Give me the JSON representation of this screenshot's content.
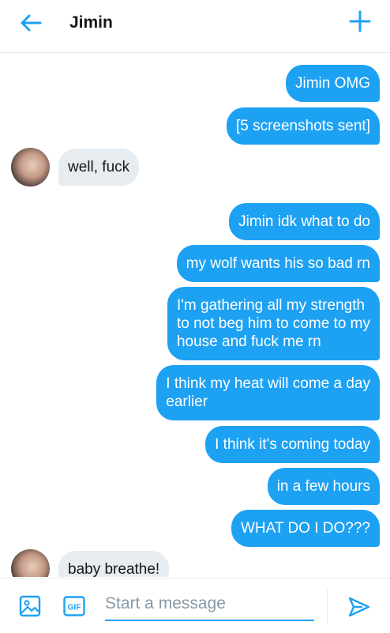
{
  "header": {
    "title": "Jimin",
    "back_icon": "arrow-left-icon",
    "new_icon": "plus-icon",
    "accent": "#1da1f2"
  },
  "messages": [
    {
      "from": "me",
      "text": "Jimin OMG"
    },
    {
      "from": "me",
      "text": "[5 screenshots sent]"
    },
    {
      "from": "them",
      "text": "well, fuck"
    },
    {
      "from": "me",
      "text": "Jimin idk what to do"
    },
    {
      "from": "me",
      "text": "my wolf wants his so bad rn"
    },
    {
      "from": "me",
      "text": "I'm gathering all my strength\nto not beg him to come to my\nhouse and fuck me rn"
    },
    {
      "from": "me",
      "text": "I think my heat will come a day\nearlier"
    },
    {
      "from": "me",
      "text": "I think it's coming today"
    },
    {
      "from": "me",
      "text": "in a few hours"
    },
    {
      "from": "me",
      "text": "WHAT DO I DO???"
    },
    {
      "from": "them",
      "text": "baby breathe!"
    }
  ],
  "composer": {
    "placeholder": "Start a message",
    "image_icon": "image-icon",
    "gif_label": "GIF",
    "send_icon": "send-icon"
  },
  "colors": {
    "sent_bubble": "#1da1f2",
    "received_bubble": "#e6ecf0"
  }
}
